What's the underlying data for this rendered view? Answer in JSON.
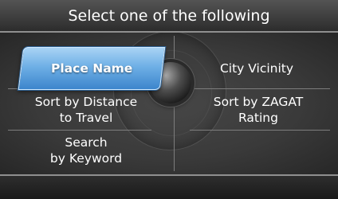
{
  "header": {
    "title": "Select one of the following"
  },
  "options": {
    "place_name": "Place Name",
    "city_vicinity": "City Vicinity",
    "sort_by_distance_line1": "Sort by Distance",
    "sort_by_distance_line2": "to Travel",
    "sort_by_zagat_line1": "Sort by ZAGAT",
    "sort_by_zagat_line2": "Rating",
    "search_line1": "Search",
    "search_line2": "by Keyword"
  },
  "colors": {
    "selected_highlight": "#6fb0e6",
    "header_bg": "#3d3d3d",
    "panel_bg": "#3a3a3a"
  },
  "state": {
    "selected_option": "Place Name"
  }
}
